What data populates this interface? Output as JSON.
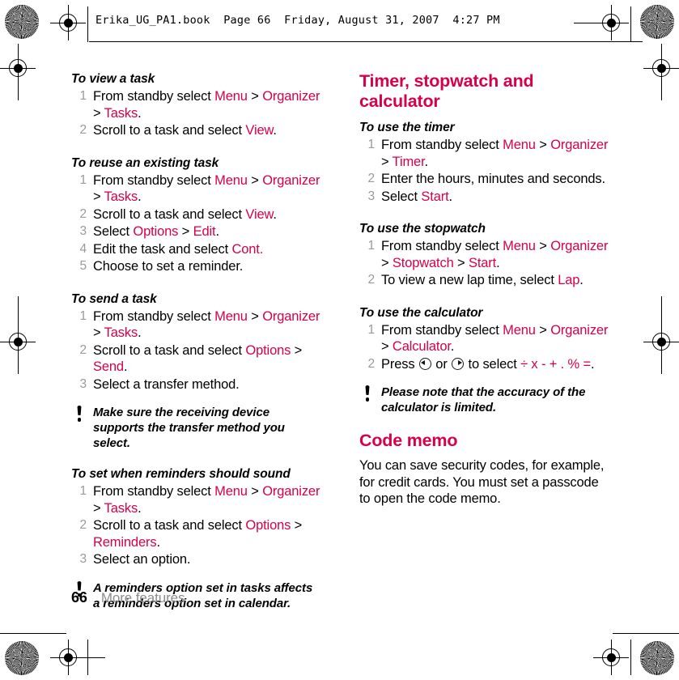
{
  "header": {
    "running_head": "Erika_UG_PA1.book  Page 66  Friday, August 31, 2007  4:27 PM"
  },
  "footer": {
    "page_number": "66",
    "chapter": "More features"
  },
  "colors": {
    "accent": "#d6004b",
    "step_number": "#9a9a9a",
    "body": "#000000",
    "footer_chapter": "#8c8c8c"
  },
  "left_column": {
    "procedures": [
      {
        "title": "To view a task",
        "steps": [
          [
            {
              "t": "From standby select ",
              "s": "plain"
            },
            {
              "t": "Menu",
              "s": "mark"
            },
            {
              "t": " > ",
              "s": "plain"
            },
            {
              "t": "Organizer",
              "s": "mark"
            },
            {
              "t": " > ",
              "s": "plain"
            },
            {
              "t": "Tasks",
              "s": "mark"
            },
            {
              "t": ".",
              "s": "plain"
            }
          ],
          [
            {
              "t": "Scroll to a task and select ",
              "s": "plain"
            },
            {
              "t": "View",
              "s": "mark"
            },
            {
              "t": ".",
              "s": "plain"
            }
          ]
        ]
      },
      {
        "title": "To reuse an existing task",
        "steps": [
          [
            {
              "t": "From standby select ",
              "s": "plain"
            },
            {
              "t": "Menu",
              "s": "mark"
            },
            {
              "t": " > ",
              "s": "plain"
            },
            {
              "t": "Organizer",
              "s": "mark"
            },
            {
              "t": " > ",
              "s": "plain"
            },
            {
              "t": "Tasks",
              "s": "mark"
            },
            {
              "t": ".",
              "s": "plain"
            }
          ],
          [
            {
              "t": "Scroll to a task and select ",
              "s": "plain"
            },
            {
              "t": "View",
              "s": "mark"
            },
            {
              "t": ".",
              "s": "plain"
            }
          ],
          [
            {
              "t": "Select ",
              "s": "plain"
            },
            {
              "t": "Options",
              "s": "mark"
            },
            {
              "t": " > ",
              "s": "plain"
            },
            {
              "t": "Edit",
              "s": "mark"
            },
            {
              "t": ".",
              "s": "plain"
            }
          ],
          [
            {
              "t": "Edit the task and select ",
              "s": "plain"
            },
            {
              "t": "Cont.",
              "s": "mark"
            }
          ],
          [
            {
              "t": "Choose to set a reminder.",
              "s": "plain"
            }
          ]
        ]
      },
      {
        "title": "To send a task",
        "steps": [
          [
            {
              "t": "From standby select ",
              "s": "plain"
            },
            {
              "t": "Menu",
              "s": "mark"
            },
            {
              "t": " > ",
              "s": "plain"
            },
            {
              "t": "Organizer",
              "s": "mark"
            },
            {
              "t": " > ",
              "s": "plain"
            },
            {
              "t": "Tasks",
              "s": "mark"
            },
            {
              "t": ".",
              "s": "plain"
            }
          ],
          [
            {
              "t": "Scroll to a task and select ",
              "s": "plain"
            },
            {
              "t": "Options",
              "s": "mark"
            },
            {
              "t": " > ",
              "s": "plain"
            },
            {
              "t": "Send",
              "s": "mark"
            },
            {
              "t": ".",
              "s": "plain"
            }
          ],
          [
            {
              "t": "Select a transfer method.",
              "s": "plain"
            }
          ]
        ]
      }
    ],
    "note_1": "Make sure the receiving device supports the transfer method you select.",
    "procedure_reminders": {
      "title": "To set when reminders should sound",
      "steps": [
        [
          {
            "t": "From standby select ",
            "s": "plain"
          },
          {
            "t": "Menu",
            "s": "mark"
          },
          {
            "t": " > ",
            "s": "plain"
          },
          {
            "t": "Organizer",
            "s": "mark"
          },
          {
            "t": " > ",
            "s": "plain"
          },
          {
            "t": "Tasks",
            "s": "mark"
          },
          {
            "t": ".",
            "s": "plain"
          }
        ],
        [
          {
            "t": "Scroll to a task and select ",
            "s": "plain"
          },
          {
            "t": "Options",
            "s": "mark"
          },
          {
            "t": " > ",
            "s": "plain"
          },
          {
            "t": "Reminders",
            "s": "mark"
          },
          {
            "t": ".",
            "s": "plain"
          }
        ],
        [
          {
            "t": "Select an option.",
            "s": "plain"
          }
        ]
      ]
    },
    "note_2": "A reminders option set in tasks affects a reminders option set in calendar."
  },
  "right_column": {
    "section_title": "Timer, stopwatch and calculator",
    "procedures": [
      {
        "title": "To use the timer",
        "steps": [
          [
            {
              "t": "From standby select ",
              "s": "plain"
            },
            {
              "t": "Menu",
              "s": "mark"
            },
            {
              "t": " > ",
              "s": "plain"
            },
            {
              "t": "Organizer",
              "s": "mark"
            },
            {
              "t": " > ",
              "s": "plain"
            },
            {
              "t": "Timer",
              "s": "mark"
            },
            {
              "t": ".",
              "s": "plain"
            }
          ],
          [
            {
              "t": "Enter the hours, minutes and seconds.",
              "s": "plain"
            }
          ],
          [
            {
              "t": "Select ",
              "s": "plain"
            },
            {
              "t": "Start",
              "s": "mark"
            },
            {
              "t": ".",
              "s": "plain"
            }
          ]
        ]
      },
      {
        "title": "To use the stopwatch",
        "steps": [
          [
            {
              "t": "From standby select ",
              "s": "plain"
            },
            {
              "t": "Menu",
              "s": "mark"
            },
            {
              "t": " > ",
              "s": "plain"
            },
            {
              "t": "Organizer",
              "s": "mark"
            },
            {
              "t": " > ",
              "s": "plain"
            },
            {
              "t": "Stopwatch",
              "s": "mark"
            },
            {
              "t": " > ",
              "s": "plain"
            },
            {
              "t": "Start",
              "s": "mark"
            },
            {
              "t": ".",
              "s": "plain"
            }
          ],
          [
            {
              "t": "To view a new lap time, select ",
              "s": "plain"
            },
            {
              "t": "Lap",
              "s": "mark"
            },
            {
              "t": ".",
              "s": "plain"
            }
          ]
        ]
      }
    ],
    "calculator": {
      "title": "To use the calculator",
      "step_1": [
        {
          "t": "From standby select ",
          "s": "plain"
        },
        {
          "t": "Menu",
          "s": "mark"
        },
        {
          "t": " > ",
          "s": "plain"
        },
        {
          "t": "Organizer",
          "s": "mark"
        },
        {
          "t": " > ",
          "s": "plain"
        },
        {
          "t": "Calculator",
          "s": "mark"
        },
        {
          "t": ".",
          "s": "plain"
        }
      ],
      "step_2_pre": "Press ",
      "step_2_mid": " or ",
      "step_2_post": " to select ",
      "step_2_operators": "÷ x - + . % =",
      "step_2_end": ".",
      "nav_left_icon": "nav-left-icon",
      "nav_right_icon": "nav-right-icon"
    },
    "note_3": "Please note that the accuracy of the calculator is limited.",
    "code_memo": {
      "title": "Code memo",
      "body": "You can save security codes, for example, for credit cards. You must set a passcode to open the code memo."
    }
  }
}
